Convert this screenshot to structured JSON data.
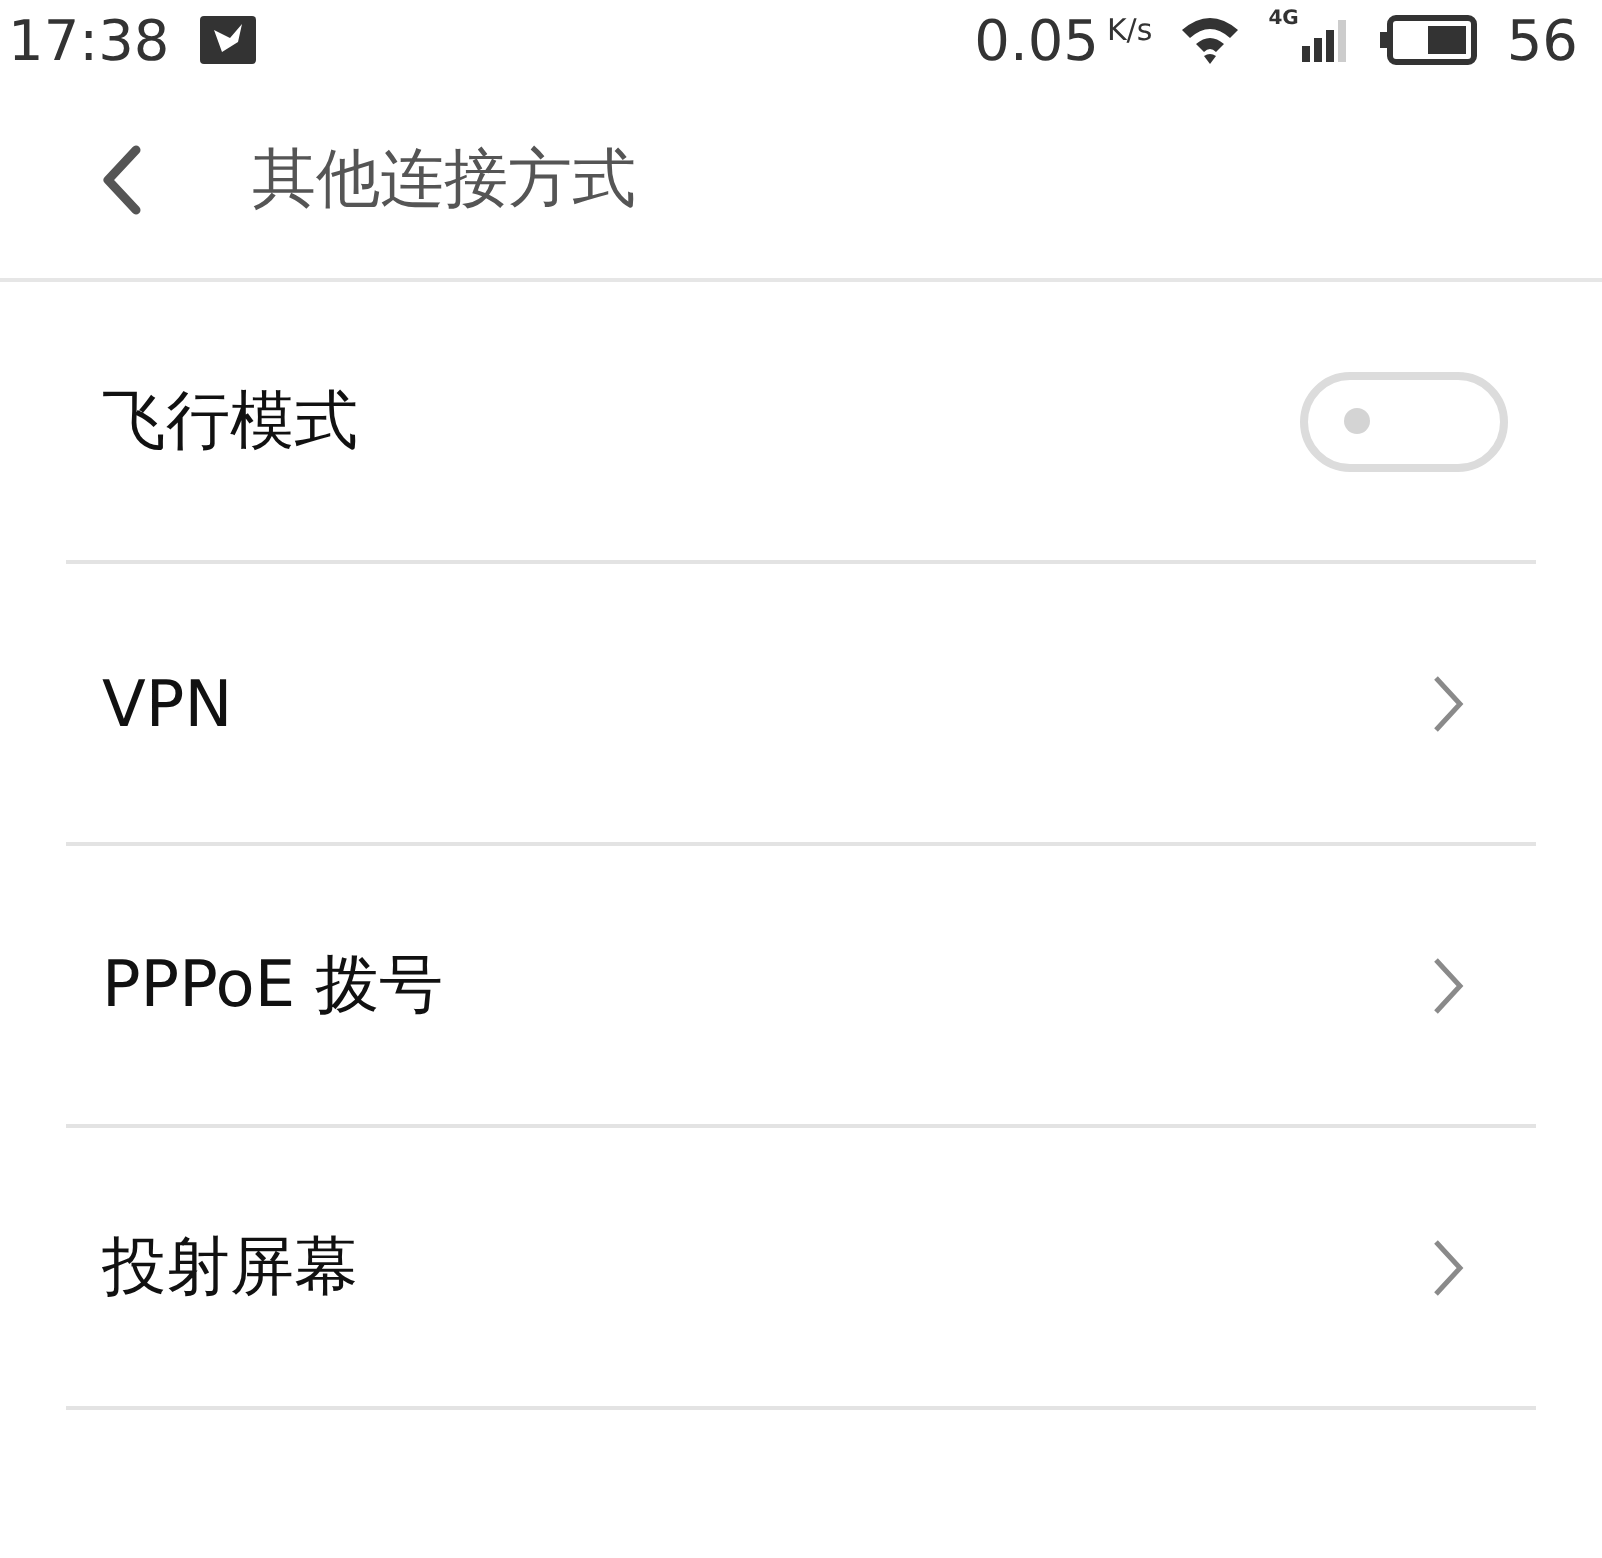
{
  "status_bar": {
    "time": "17:38",
    "speed": "0.05",
    "speed_unit": "K/s",
    "network": "4G",
    "battery_text": "56"
  },
  "header": {
    "title": "其他连接方式"
  },
  "items": [
    {
      "kind": "toggle",
      "label": "飞行模式",
      "on": false
    },
    {
      "kind": "link",
      "label": "VPN"
    },
    {
      "kind": "link",
      "label": "PPPoE 拨号"
    },
    {
      "kind": "link",
      "label": "投射屏幕"
    }
  ]
}
